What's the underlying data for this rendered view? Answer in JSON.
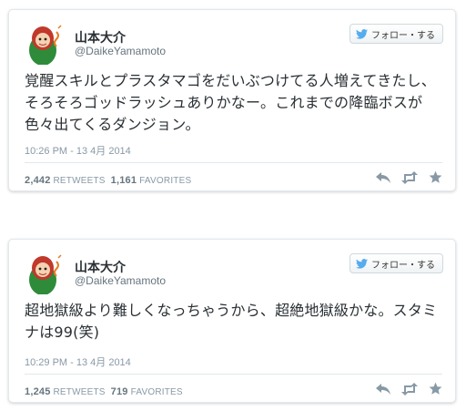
{
  "tweets": [
    {
      "name": "山本大介",
      "handle": "@DaikeYamamoto",
      "follow_label": "フォロー・する",
      "text": "覚醒スキルとプラスタマゴをだいぶつけてる人増えてきたし、そろそろゴッドラッシュありかなー。これまでの降臨ボスが色々出てくるダンジョン。",
      "timestamp": "10:26 PM - 13 4月 2014",
      "retweets": "2,442",
      "retweets_label": "RETWEETS",
      "favorites": "1,161",
      "favorites_label": "FAVORITES"
    },
    {
      "name": "山本大介",
      "handle": "@DaikeYamamoto",
      "follow_label": "フォロー・する",
      "text": "超地獄級より難しくなっちゃうから、超絶地獄級かな。スタミナは99(笑)",
      "timestamp": "10:29 PM - 13 4月 2014",
      "retweets": "1,245",
      "retweets_label": "RETWEETS",
      "favorites": "719",
      "favorites_label": "FAVORITES"
    }
  ],
  "icons": {
    "bird": "twitter-bird-icon",
    "reply": "reply-icon",
    "retweet": "retweet-icon",
    "favorite": "star-icon"
  },
  "colors": {
    "brand": "#55acee",
    "icon_gray": "#8899a6"
  }
}
